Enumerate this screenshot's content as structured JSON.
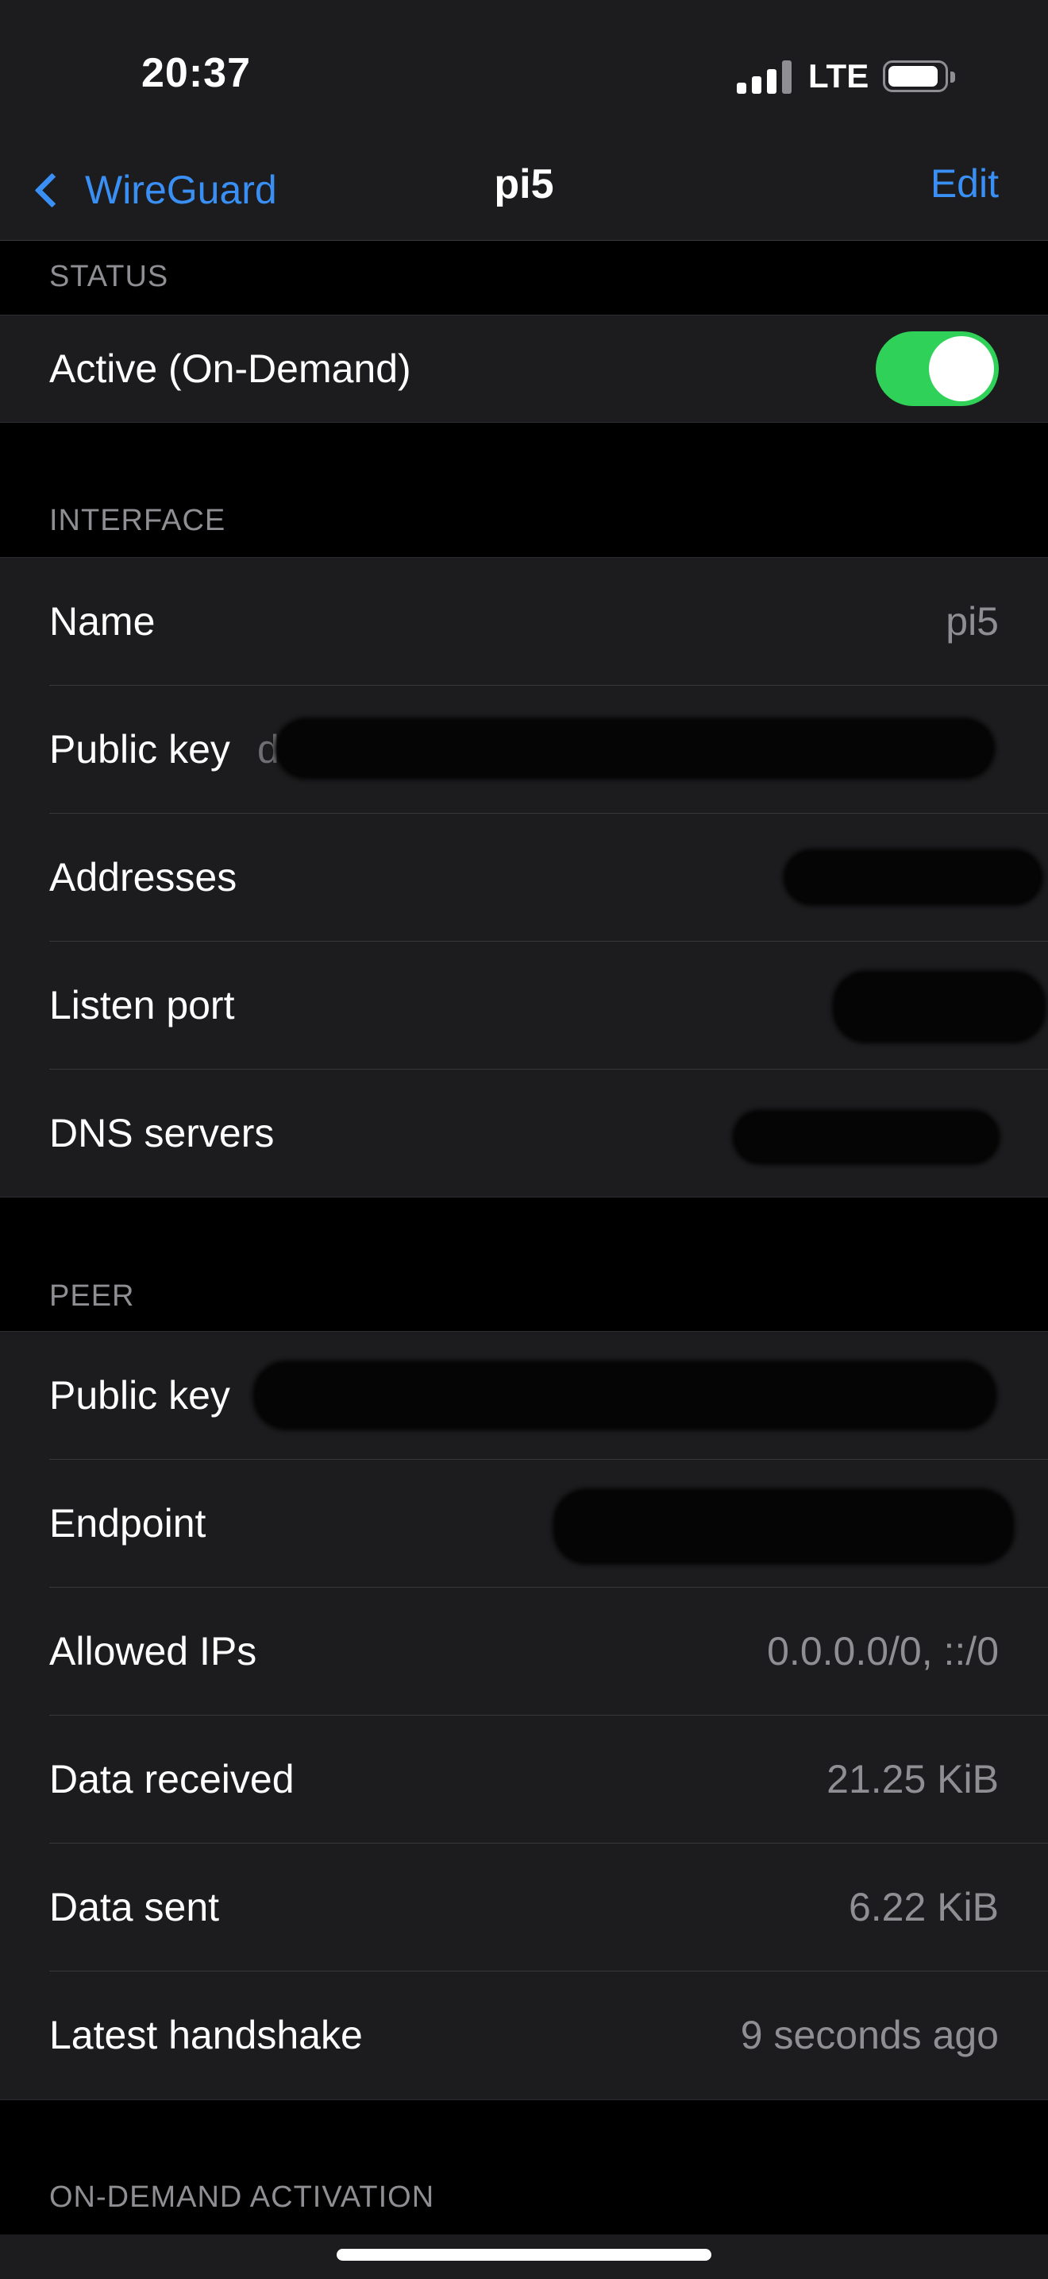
{
  "status_bar": {
    "time": "20:37",
    "network": "LTE",
    "signal_icon": "cellular-signal-icon",
    "battery_icon": "battery-icon"
  },
  "nav": {
    "back_label": "WireGuard",
    "title": "pi5",
    "edit_label": "Edit"
  },
  "sections": {
    "status": {
      "header": "STATUS",
      "active_label": "Active (On-Demand)",
      "toggle_on": true,
      "toggle_color": "#30d158"
    },
    "interface": {
      "header": "INTERFACE",
      "name_label": "Name",
      "name_value": "pi5",
      "public_key_label": "Public key",
      "public_key_value": "dRFR                                                  Or",
      "addresses_label": "Addresses",
      "addresses_value": "",
      "listen_port_label": "Listen port",
      "listen_port_value": "",
      "dns_label": "DNS servers",
      "dns_value": ""
    },
    "peer": {
      "header": "PEER",
      "public_key_label": "Public key",
      "public_key_value": "",
      "endpoint_label": "Endpoint",
      "endpoint_value": "",
      "allowed_ips_label": "Allowed IPs",
      "allowed_ips_value": "0.0.0.0/0, ::/0",
      "data_received_label": "Data received",
      "data_received_value": "21.25 KiB",
      "data_sent_label": "Data sent",
      "data_sent_value": "6.22 KiB",
      "handshake_label": "Latest handshake",
      "handshake_value": "9 seconds ago"
    },
    "on_demand": {
      "header": "ON-DEMAND ACTIVATION"
    }
  },
  "colors": {
    "accent": "#3a8ff5",
    "background": "#000000",
    "cell": "#1c1c1e",
    "secondary_text": "#8e8e93"
  }
}
